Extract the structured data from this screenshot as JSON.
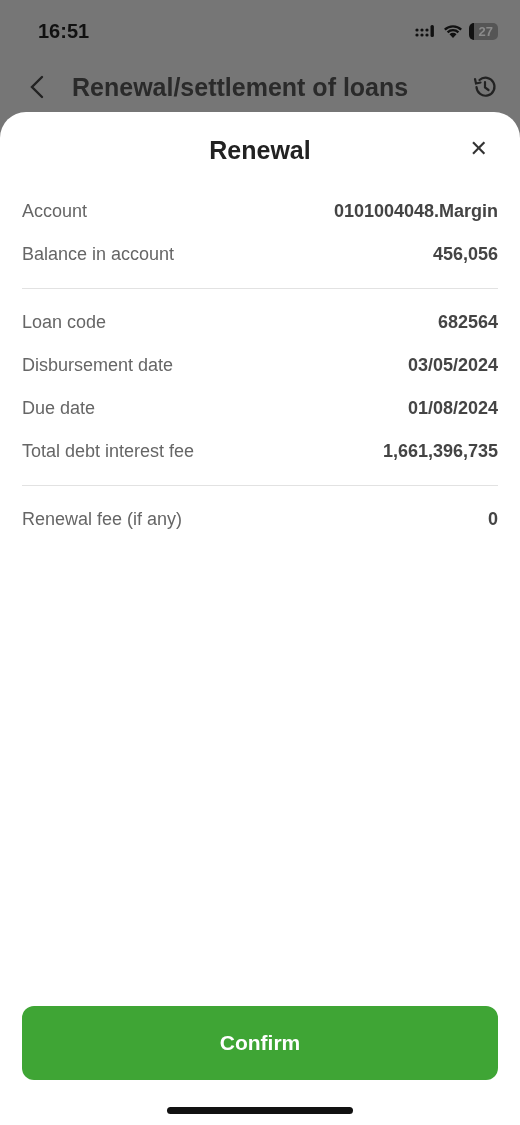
{
  "status_bar": {
    "time": "16:51",
    "battery": "27"
  },
  "header": {
    "title": "Renewal/settlement of loans"
  },
  "sheet": {
    "title": "Renewal",
    "close": "✕",
    "sections": [
      {
        "rows": [
          {
            "label": "Account",
            "value": "0101004048.Margin"
          },
          {
            "label": "Balance in account",
            "value": "456,056"
          }
        ]
      },
      {
        "rows": [
          {
            "label": "Loan code",
            "value": "682564"
          },
          {
            "label": "Disbursement date",
            "value": "03/05/2024"
          },
          {
            "label": "Due date",
            "value": "01/08/2024"
          },
          {
            "label": "Total debt interest fee",
            "value": "1,661,396,735"
          }
        ]
      },
      {
        "rows": [
          {
            "label": "Renewal fee (if any)",
            "value": "0"
          }
        ]
      }
    ],
    "confirm": "Confirm"
  }
}
